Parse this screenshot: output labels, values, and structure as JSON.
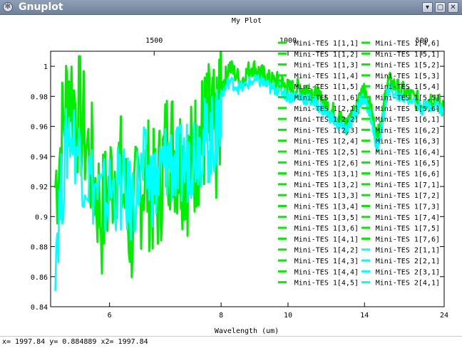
{
  "window": {
    "title": "Gnuplot",
    "icon": "gear-icon",
    "controls": [
      "chevron-down-icon",
      "restore-icon",
      "close-icon"
    ]
  },
  "status": {
    "text": "x= 1997.84 y= 0.884889 x2= 1997.84"
  },
  "chart_data": {
    "type": "line",
    "title": "My Plot",
    "xlabel": "Wavelength (um)",
    "ylabel": "",
    "xlim": [
      5.3,
      24
    ],
    "ylim": [
      0.84,
      1.01
    ],
    "x_ticks": [
      "6",
      "8",
      "10",
      "14",
      "24"
    ],
    "x_tick_values": [
      6,
      8,
      10,
      14,
      24
    ],
    "x2_ticks": [
      "1500",
      "1000",
      "500"
    ],
    "x2_tick_values": [
      1500,
      1000,
      500
    ],
    "y_ticks": [
      "1",
      "0.98",
      "0.96",
      "0.94",
      "0.92",
      "0.9",
      "0.88",
      "0.86",
      "0.84"
    ],
    "y_tick_values": [
      1,
      0.98,
      0.96,
      0.94,
      0.92,
      0.9,
      0.88,
      0.86,
      0.84
    ],
    "legend_position": "top-right",
    "colors": {
      "green": "#00ee00",
      "cyan": "#00ffff"
    },
    "legend": [
      {
        "name": "Mini-TES 1[1,1]",
        "color": "green"
      },
      {
        "name": "Mini-TES 1[1,2]",
        "color": "green"
      },
      {
        "name": "Mini-TES 1[1,3]",
        "color": "green"
      },
      {
        "name": "Mini-TES 1[1,4]",
        "color": "green"
      },
      {
        "name": "Mini-TES 1[1,5]",
        "color": "green"
      },
      {
        "name": "Mini-TES 1[1,6]",
        "color": "green"
      },
      {
        "name": "Mini-TES 1[2,1]",
        "color": "green"
      },
      {
        "name": "Mini-TES 1[2,2]",
        "color": "green"
      },
      {
        "name": "Mini-TES 1[2,3]",
        "color": "green"
      },
      {
        "name": "Mini-TES 1[2,4]",
        "color": "green"
      },
      {
        "name": "Mini-TES 1[2,5]",
        "color": "green"
      },
      {
        "name": "Mini-TES 1[2,6]",
        "color": "green"
      },
      {
        "name": "Mini-TES 1[3,1]",
        "color": "green"
      },
      {
        "name": "Mini-TES 1[3,2]",
        "color": "green"
      },
      {
        "name": "Mini-TES 1[3,3]",
        "color": "green"
      },
      {
        "name": "Mini-TES 1[3,4]",
        "color": "green"
      },
      {
        "name": "Mini-TES 1[3,5]",
        "color": "green"
      },
      {
        "name": "Mini-TES 1[3,6]",
        "color": "green"
      },
      {
        "name": "Mini-TES 1[4,1]",
        "color": "green"
      },
      {
        "name": "Mini-TES 1[4,2]",
        "color": "green"
      },
      {
        "name": "Mini-TES 1[4,3]",
        "color": "green"
      },
      {
        "name": "Mini-TES 1[4,4]",
        "color": "green"
      },
      {
        "name": "Mini-TES 1[4,5]",
        "color": "green"
      },
      {
        "name": "Mini-TES 1[4,6]",
        "color": "green"
      },
      {
        "name": "Mini-TES 1[5,1]",
        "color": "green"
      },
      {
        "name": "Mini-TES 1[5,2]",
        "color": "green"
      },
      {
        "name": "Mini-TES 1[5,3]",
        "color": "green"
      },
      {
        "name": "Mini-TES 1[5,4]",
        "color": "green"
      },
      {
        "name": "Mini-TES 1[5,5]",
        "color": "green"
      },
      {
        "name": "Mini-TES 1[5,6]",
        "color": "green"
      },
      {
        "name": "Mini-TES 1[6,1]",
        "color": "green"
      },
      {
        "name": "Mini-TES 1[6,2]",
        "color": "green"
      },
      {
        "name": "Mini-TES 1[6,3]",
        "color": "green"
      },
      {
        "name": "Mini-TES 1[6,4]",
        "color": "green"
      },
      {
        "name": "Mini-TES 1[6,5]",
        "color": "green"
      },
      {
        "name": "Mini-TES 1[6,6]",
        "color": "green"
      },
      {
        "name": "Mini-TES 1[7,1]",
        "color": "green"
      },
      {
        "name": "Mini-TES 1[7,2]",
        "color": "green"
      },
      {
        "name": "Mini-TES 1[7,3]",
        "color": "green"
      },
      {
        "name": "Mini-TES 1[7,4]",
        "color": "green"
      },
      {
        "name": "Mini-TES 1[7,5]",
        "color": "green"
      },
      {
        "name": "Mini-TES 1[7,6]",
        "color": "green"
      },
      {
        "name": "Mini-TES 2[1,1]",
        "color": "cyan"
      },
      {
        "name": "Mini-TES 2[2,1]",
        "color": "cyan"
      },
      {
        "name": "Mini-TES 2[3,1]",
        "color": "cyan"
      },
      {
        "name": "Mini-TES 2[4,1]",
        "color": "cyan"
      }
    ],
    "series": [
      {
        "name": "Mini-TES 1",
        "color": "green",
        "x": [
          5.35,
          5.5,
          5.7,
          5.9,
          6.1,
          6.3,
          6.5,
          6.7,
          6.9,
          7.1,
          7.3,
          7.5,
          7.7,
          7.9,
          8.0,
          8.2,
          8.5,
          8.8,
          9.1,
          9.4,
          9.7,
          10.0,
          10.4,
          10.8,
          11.2,
          11.6,
          12.0,
          12.4,
          12.8,
          13.2,
          13.6,
          14.0,
          14.5,
          15.0,
          15.5,
          16.0,
          17.0,
          18.5,
          20.0,
          22.0,
          24.0
        ],
        "y": [
          0.92,
          0.99,
          0.95,
          0.9,
          0.94,
          0.89,
          0.93,
          0.91,
          0.95,
          0.94,
          0.93,
          0.95,
          0.96,
          0.95,
          0.985,
          1.0,
          0.99,
          1.0,
          0.995,
          0.99,
          0.99,
          0.985,
          0.985,
          0.985,
          0.98,
          0.975,
          0.97,
          0.965,
          0.96,
          0.97,
          0.975,
          0.985,
          0.97,
          0.95,
          0.97,
          0.99,
          0.985,
          0.98,
          0.975,
          0.98,
          0.97
        ],
        "band": 0.045
      },
      {
        "name": "Mini-TES 2",
        "color": "cyan",
        "x": [
          5.35,
          5.5,
          5.7,
          5.9,
          6.1,
          6.3,
          6.5,
          6.7,
          6.9,
          7.1,
          7.3,
          7.5,
          7.7,
          7.9,
          8.0,
          8.2,
          8.5,
          8.8,
          9.1,
          9.4,
          9.7,
          10.0,
          10.4,
          10.8,
          11.2,
          11.6,
          12.0,
          12.4,
          12.8,
          13.2,
          13.6,
          14.0,
          14.5,
          15.0,
          15.5,
          16.0,
          17.0,
          18.5,
          20.0,
          22.0,
          24.0
        ],
        "y": [
          0.88,
          0.96,
          0.93,
          0.91,
          0.92,
          0.91,
          0.93,
          0.92,
          0.94,
          0.93,
          0.94,
          0.95,
          0.95,
          0.955,
          0.98,
          0.99,
          0.985,
          0.99,
          0.99,
          0.985,
          0.985,
          0.98,
          0.98,
          0.978,
          0.975,
          0.97,
          0.965,
          0.96,
          0.958,
          0.965,
          0.975,
          0.98,
          0.965,
          0.945,
          0.965,
          0.985,
          0.98,
          0.978,
          0.972,
          0.975,
          0.97
        ],
        "band": 0.03
      }
    ]
  }
}
